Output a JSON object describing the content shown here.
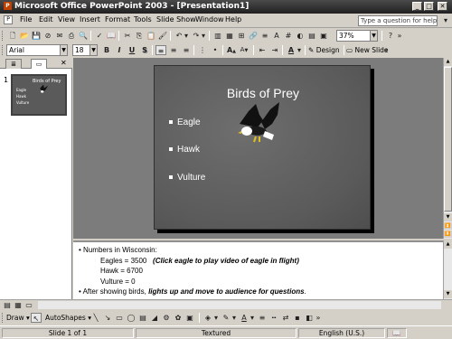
{
  "window": {
    "title": "Microsoft Office PowerPoint 2003 - [Presentation1]",
    "minimize_icon": "minimize-icon",
    "maximize_icon": "maximize-icon",
    "close_icon": "close-icon"
  },
  "menubar": {
    "items": [
      "File",
      "Edit",
      "View",
      "Insert",
      "Format",
      "Tools",
      "Slide Show",
      "Window",
      "Help"
    ],
    "help_placeholder": "Type a question for help"
  },
  "standard_toolbar": {
    "zoom": "37%"
  },
  "formatting_toolbar": {
    "font": "Arial",
    "font_size": "18",
    "bold_label": "B",
    "italic_label": "I",
    "underline_label": "U",
    "shadow_label": "S",
    "grow_font_label": "A",
    "shrink_font_label": "A",
    "font_color_label": "A",
    "design_label": "Design",
    "new_slide_label": "New Slide"
  },
  "slides_pane": {
    "slide_number": "1",
    "thumb_title": "Birds of Prey",
    "thumb_bullets": [
      "Eagle",
      "Hawk",
      "Vulture"
    ]
  },
  "slide": {
    "title": "Birds of Prey",
    "bullets": [
      "Eagle",
      "Hawk",
      "Vulture"
    ],
    "background_color": "#5f5f5f"
  },
  "notes": {
    "line1": "Numbers in Wisconsin:",
    "eagles": "Eagles = 3500",
    "eagles_note": "(Click eagle to play video of eagle in flight)",
    "hawk": "Hawk = 6700",
    "vulture": "Vulture = 0",
    "line_last_prefix": "After showing birds, ",
    "line_last_emph": "lights up and move to audience for questions",
    "line_last_suffix": "."
  },
  "drawing_toolbar": {
    "draw_label": "Draw",
    "autoshapes_label": "AutoShapes"
  },
  "statusbar": {
    "slide_info": "Slide 1 of 1",
    "design": "Textured",
    "language": "English (U.S.)"
  }
}
